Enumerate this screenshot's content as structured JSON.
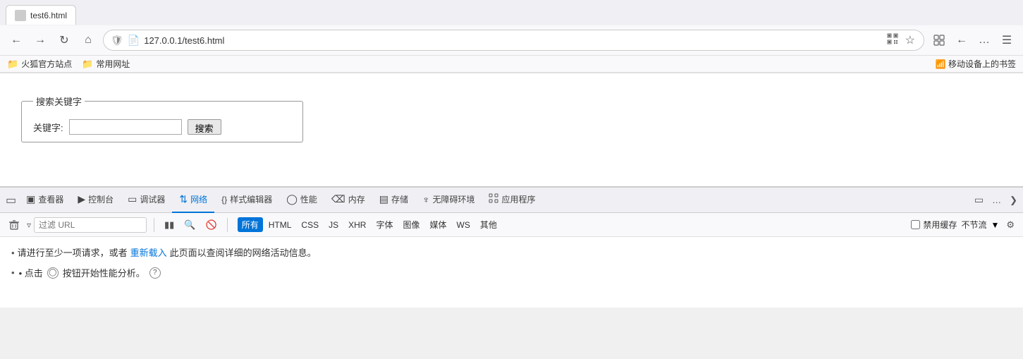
{
  "browser": {
    "tab_label": "test6.html",
    "address": "127.0.0.1/test6.html",
    "back_btn": "←",
    "forward_btn": "→",
    "reload_btn": "↺",
    "home_btn": "⌂",
    "qr_label": "QR",
    "star_label": "★",
    "extensions_label": "⊞",
    "menu_label": "≡",
    "bookmarks": [
      {
        "label": "火狐官方站点"
      },
      {
        "label": "常用网址"
      }
    ],
    "mobile_bookmarks": "移动设备上的书签"
  },
  "page": {
    "fieldset_legend": "搜索关键字",
    "search_label": "关键字:",
    "search_placeholder": "",
    "search_button": "搜索"
  },
  "devtools": {
    "tabs": [
      {
        "id": "inspector",
        "icon": "□",
        "label": "查看器"
      },
      {
        "id": "console",
        "icon": "▷",
        "label": "控制台"
      },
      {
        "id": "debugger",
        "icon": "⊡",
        "label": "调试器"
      },
      {
        "id": "network",
        "icon": "⇅",
        "label": "网络",
        "active": true
      },
      {
        "id": "style-editor",
        "icon": "{}",
        "label": "样式编辑器"
      },
      {
        "id": "performance",
        "icon": "◎",
        "label": "性能"
      },
      {
        "id": "memory",
        "icon": "⊗",
        "label": "内存"
      },
      {
        "id": "storage",
        "icon": "≡",
        "label": "存储"
      },
      {
        "id": "accessibility",
        "icon": "♿",
        "label": "无障碍环境"
      },
      {
        "id": "app",
        "icon": "⊞",
        "label": "应用程序"
      }
    ],
    "toolbar": {
      "pause_label": "||",
      "search_label": "🔍",
      "block_label": "🚫",
      "filter_placeholder": "过滤 URL",
      "filter_types": [
        "所有",
        "HTML",
        "CSS",
        "JS",
        "XHR",
        "字体",
        "图像",
        "媒体",
        "WS",
        "其他"
      ],
      "active_filter": "所有",
      "disable_cache_label": "禁用缓存",
      "throttle_label": "不节流",
      "settings_label": "⚙"
    },
    "messages": {
      "network_message": "请进行至少一项请求，或者",
      "network_link": "重新载入",
      "network_message2": "此页面以查阅详细的网络活动信息。",
      "perf_message1": "• 点击",
      "perf_message2": "按钮开始性能分析。",
      "perf_help": "?"
    }
  }
}
